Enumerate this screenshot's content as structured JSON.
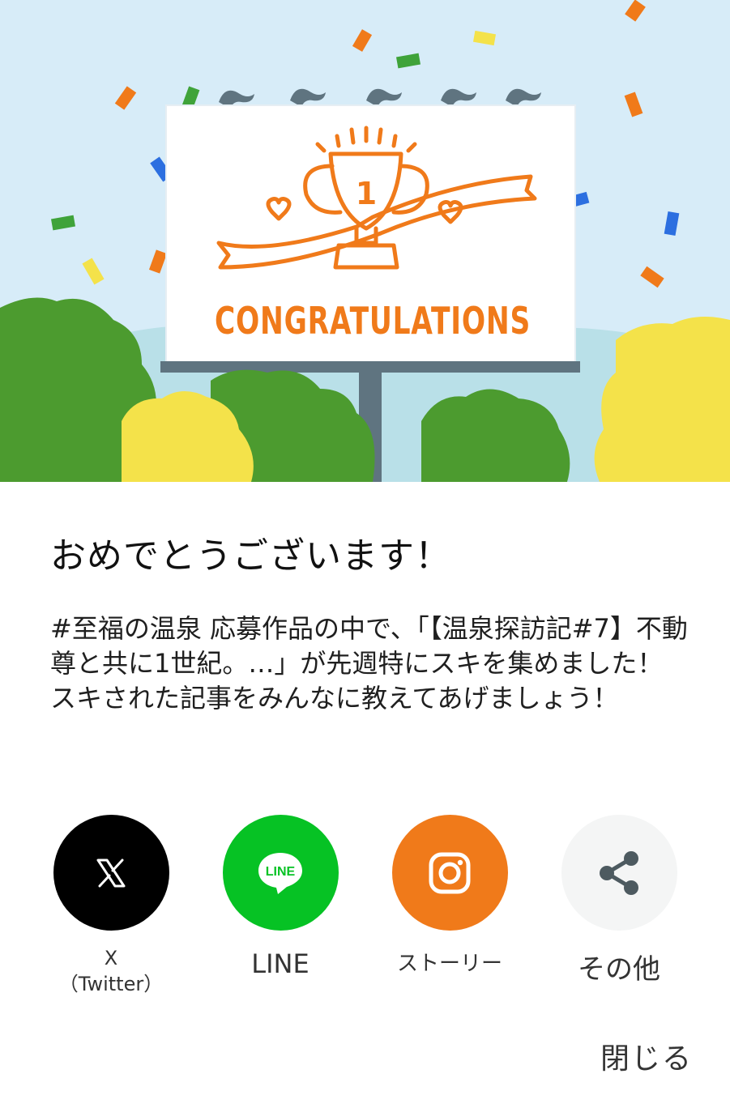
{
  "hero": {
    "sign_text": "CONGRATULATIONS",
    "trophy_number": "1",
    "colors": {
      "sky": "#d7ecf8",
      "accent_orange": "#f07a1a",
      "green": "#4c9b2f",
      "yellow": "#f4e24a",
      "billboard_pole": "#5f7480"
    }
  },
  "title": "おめでとうございます！",
  "message": "#至福の温泉 応募作品の中で、「【温泉探訪記#7】不動尊と共に1世紀。…」が先週特にスキを集めました！\nスキされた記事をみんなに教えてあげましょう！",
  "share": [
    {
      "label": "X\n（Twitter）",
      "icon": "x-logo-icon",
      "bg": "#000000"
    },
    {
      "label": "LINE",
      "icon_text": "LINE",
      "icon": "line-logo-icon",
      "bg": "#06c224"
    },
    {
      "label": "ストーリー",
      "icon": "instagram-icon",
      "bg": "#f07a1a"
    },
    {
      "label": "その他",
      "icon": "share-icon",
      "bg": "#f4f5f5"
    }
  ],
  "close_label": "閉じる"
}
